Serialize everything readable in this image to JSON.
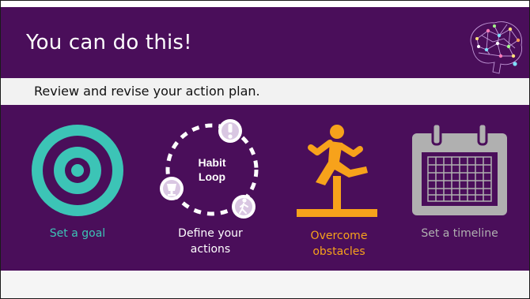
{
  "header": {
    "title": "You can do this!",
    "logo_icon": "brain-network-icon"
  },
  "subtitle": "Review and revise your action plan.",
  "tiles": [
    {
      "label": "Set a goal",
      "icon": "target-icon",
      "color": "#3cc4b6"
    },
    {
      "label": "Define your actions",
      "icon": "habit-loop-icon",
      "center_text": "Habit Loop",
      "color": "#ffffff"
    },
    {
      "label": "Overcome obstacles",
      "icon": "hurdle-runner-icon",
      "color": "#f7a21b"
    },
    {
      "label": "Set a timeline",
      "icon": "calendar-icon",
      "color": "#b0b0b0"
    }
  ],
  "colors": {
    "purple": "#4a0e5a",
    "teal": "#3cc4b6",
    "orange": "#f7a21b",
    "gray": "#b0b0b0"
  }
}
